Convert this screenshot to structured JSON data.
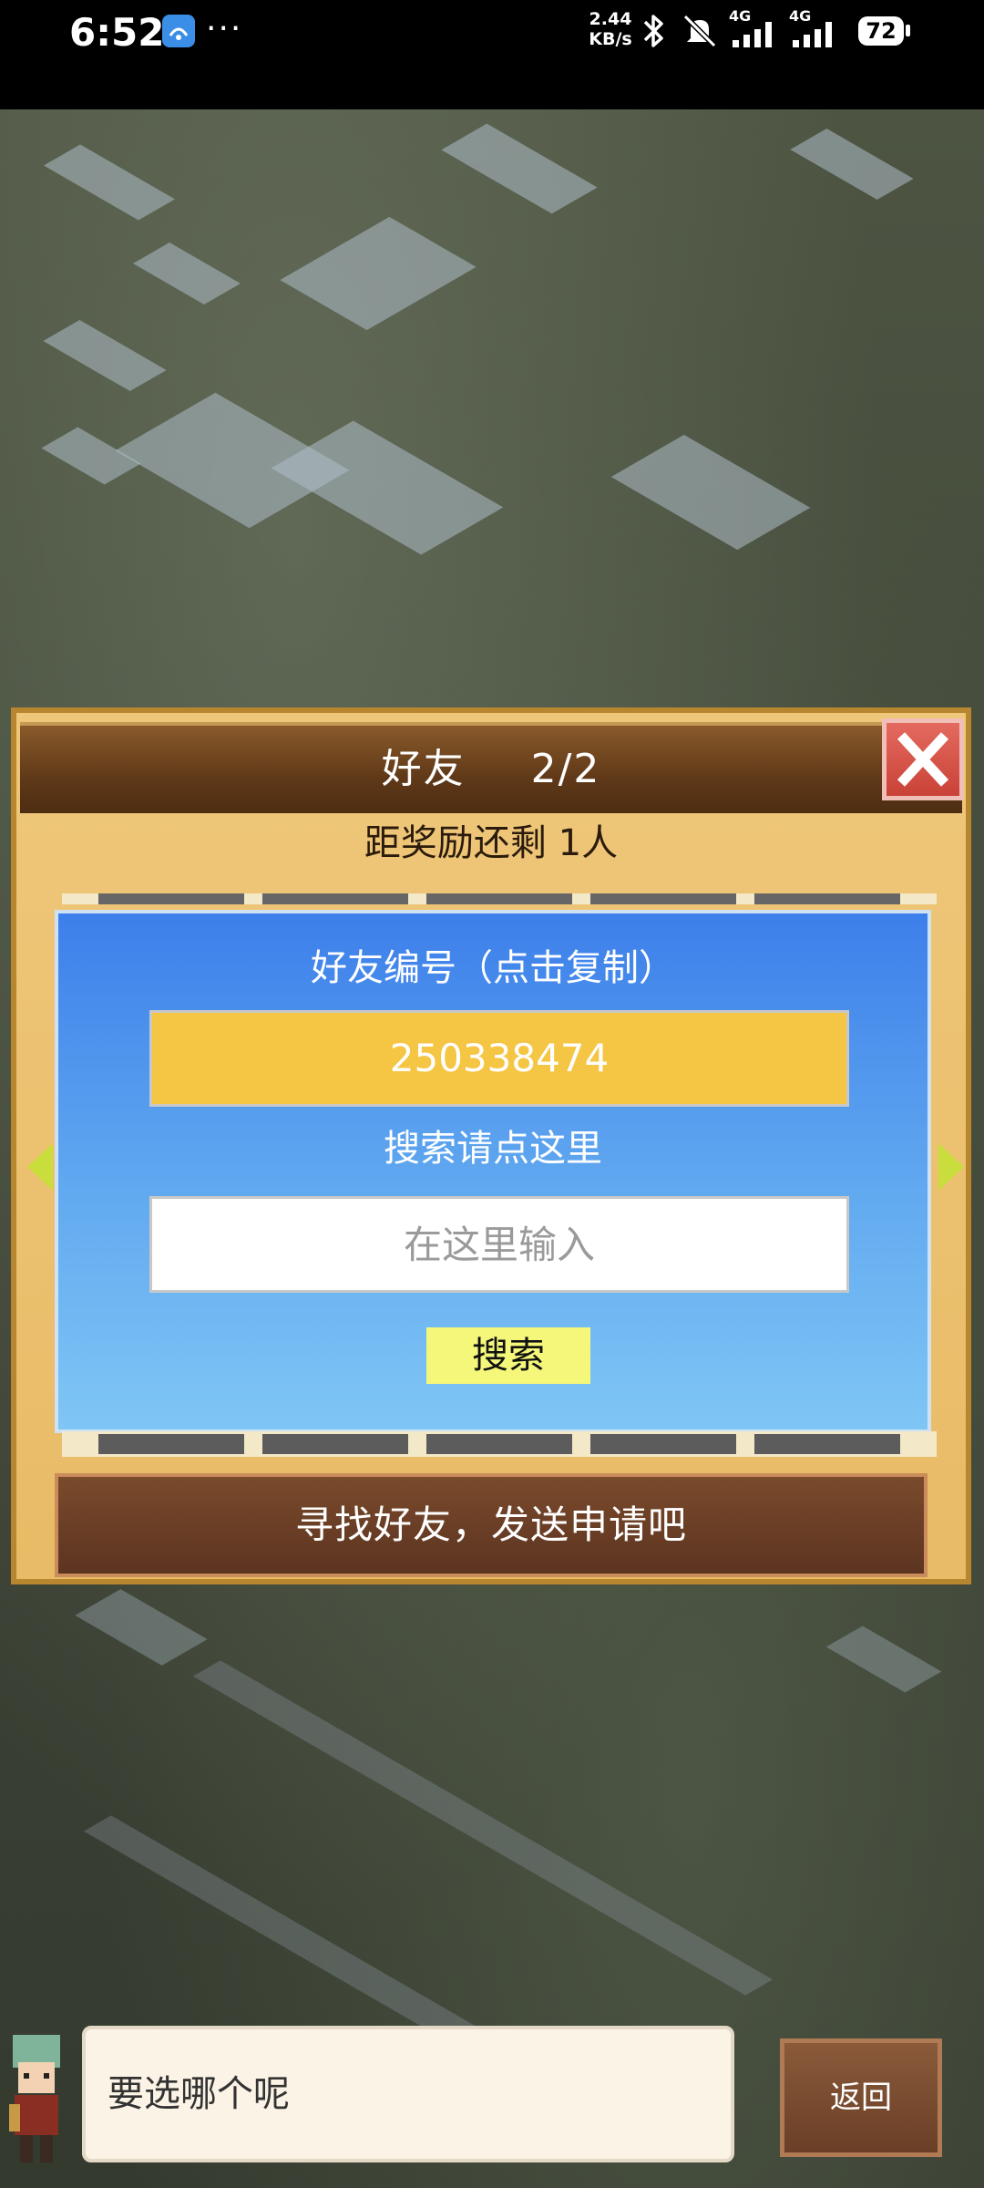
{
  "status_bar": {
    "time": "6:52",
    "more": "···",
    "net_speed_value": "2.44",
    "net_speed_unit": "KB/s",
    "network_1": "4G",
    "network_2": "4G",
    "battery": "72"
  },
  "dialog": {
    "title_label": "好友",
    "title_count": "2/2",
    "subtitle": "距奖励还剩 1人",
    "id_label": "好友编号（点击复制）",
    "id_value": "250338474",
    "search_label": "搜索请点这里",
    "search_placeholder": "在这里输入",
    "search_button": "搜索",
    "find_banner": "寻找好友，发送申请吧"
  },
  "bottom": {
    "speech": "要选哪个呢",
    "back_button": "返回"
  },
  "colors": {
    "accent_gold": "#f5c544",
    "panel_blue": "#3d7fea",
    "close_red": "#c94237",
    "search_yellow": "#f4f77a"
  },
  "icons": [
    "app-icon",
    "bluetooth-icon",
    "mute-icon",
    "signal-icon",
    "battery-icon",
    "close-icon",
    "arrow-left-icon",
    "arrow-right-icon",
    "character-avatar"
  ]
}
